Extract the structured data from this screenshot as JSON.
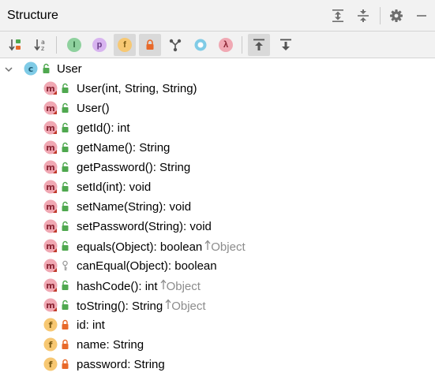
{
  "panel": {
    "title": "Structure"
  },
  "header_icons": {
    "expand_all": "expand-all-icon",
    "collapse_all": "collapse-all-icon",
    "settings": "gear-icon",
    "hide": "minimize-icon"
  },
  "toolbar": {
    "buttons": [
      {
        "icon": "sort-by-visibility-icon",
        "glyph": "",
        "active": false
      },
      {
        "icon": "sort-alphabetically-icon",
        "glyph": "",
        "active": false
      },
      {
        "icon": "show-inherited-icon",
        "glyph": "I",
        "active": false
      },
      {
        "icon": "show-properties-icon",
        "glyph": "p",
        "active": false
      },
      {
        "icon": "show-fields-icon",
        "glyph": "f",
        "active": true
      },
      {
        "icon": "show-non-public-icon",
        "glyph": "",
        "active": true
      },
      {
        "icon": "show-anonymous-classes-icon",
        "glyph": "",
        "active": false
      },
      {
        "icon": "show-interfaces-icon",
        "glyph": "",
        "active": false
      },
      {
        "icon": "show-lambdas-icon",
        "glyph": "λ",
        "active": false
      },
      {
        "icon": "autoscroll-to-source-icon",
        "glyph": "",
        "active": true
      },
      {
        "icon": "autoscroll-from-source-icon",
        "glyph": "",
        "active": false
      }
    ]
  },
  "colors": {
    "method_badge": "#f0a8b3",
    "field_badge": "#f7c873",
    "class_badge": "#7fcbe6",
    "property_badge": "#d8b4f0",
    "public_lock": "#4fa84f",
    "private_lock": "#e8692a",
    "inherited_text": "#8c8c8c"
  },
  "tree": {
    "class_name": "User",
    "class_icon": "class-icon",
    "members": [
      {
        "kind": "method",
        "visibility": "public",
        "text": "User(int, String, String)",
        "inherited_from": ""
      },
      {
        "kind": "method",
        "visibility": "public",
        "text": "User()",
        "inherited_from": ""
      },
      {
        "kind": "method",
        "visibility": "public",
        "text": "getId(): int",
        "inherited_from": ""
      },
      {
        "kind": "method",
        "visibility": "public",
        "text": "getName(): String",
        "inherited_from": ""
      },
      {
        "kind": "method",
        "visibility": "public",
        "text": "getPassword(): String",
        "inherited_from": ""
      },
      {
        "kind": "method",
        "visibility": "public",
        "text": "setId(int): void",
        "inherited_from": ""
      },
      {
        "kind": "method",
        "visibility": "public",
        "text": "setName(String): void",
        "inherited_from": ""
      },
      {
        "kind": "method",
        "visibility": "public",
        "text": "setPassword(String): void",
        "inherited_from": ""
      },
      {
        "kind": "method",
        "visibility": "public",
        "text": "equals(Object): boolean",
        "inherited_from": "Object"
      },
      {
        "kind": "method",
        "visibility": "protected",
        "text": "canEqual(Object): boolean",
        "inherited_from": ""
      },
      {
        "kind": "method",
        "visibility": "public",
        "text": "hashCode(): int",
        "inherited_from": "Object"
      },
      {
        "kind": "method",
        "visibility": "public",
        "text": "toString(): String",
        "inherited_from": "Object"
      },
      {
        "kind": "field",
        "visibility": "private",
        "text": "id: int",
        "inherited_from": ""
      },
      {
        "kind": "field",
        "visibility": "private",
        "text": "name: String",
        "inherited_from": ""
      },
      {
        "kind": "field",
        "visibility": "private",
        "text": "password: String",
        "inherited_from": ""
      }
    ]
  }
}
